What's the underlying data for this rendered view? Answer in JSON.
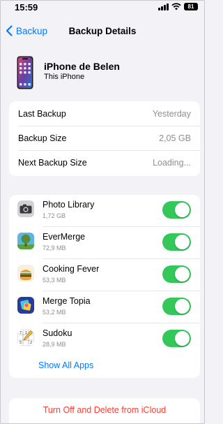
{
  "status_bar": {
    "time": "15:59",
    "battery": "81"
  },
  "nav": {
    "back_label": "Backup",
    "title": "Backup Details"
  },
  "device": {
    "name": "iPhone de Belen",
    "subtitle": "This iPhone"
  },
  "backup_info": [
    {
      "label": "Last Backup",
      "value": "Yesterday"
    },
    {
      "label": "Backup Size",
      "value": "2,05 GB"
    },
    {
      "label": "Next Backup Size",
      "value": "Loading..."
    }
  ],
  "apps": [
    {
      "name": "Photo Library",
      "size": "1,72 GB",
      "icon": "camera-icon",
      "enabled": true
    },
    {
      "name": "EverMerge",
      "size": "72,9 MB",
      "icon": "evermerge-icon",
      "enabled": true
    },
    {
      "name": "Cooking Fever",
      "size": "53,3 MB",
      "icon": "cooking-fever-icon",
      "enabled": true
    },
    {
      "name": "Merge Topia",
      "size": "53,2 MB",
      "icon": "merge-topia-icon",
      "enabled": true
    },
    {
      "name": "Sudoku",
      "size": "28,9 MB",
      "icon": "sudoku-icon",
      "enabled": true
    }
  ],
  "show_all_apps": "Show All Apps",
  "delete_action": "Turn Off and Delete from iCloud",
  "colors": {
    "accent": "#007aff",
    "toggle_on": "#34c759",
    "destructive": "#ff3b30",
    "background": "#f2f2f7"
  }
}
